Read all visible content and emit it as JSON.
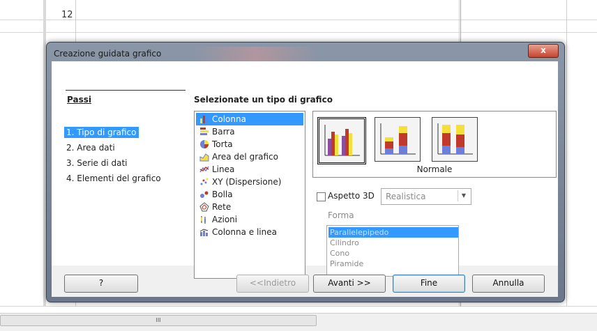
{
  "spreadsheet": {
    "visible_row_number": "12",
    "hscroll_thumb_label": "III"
  },
  "dialog": {
    "title": "Creazione guidata grafico",
    "close_label": "x",
    "steps": {
      "title": "Passi",
      "items": [
        "1. Tipo di grafico",
        "2. Area dati",
        "3. Serie di dati",
        "4. Elementi del grafico"
      ],
      "selected_index": 0
    },
    "chart_type": {
      "section_title": "Selezionate un tipo di grafico",
      "types": [
        {
          "label": "Colonna",
          "icon": "column-chart-icon"
        },
        {
          "label": "Barra",
          "icon": "bar-chart-icon"
        },
        {
          "label": "Torta",
          "icon": "pie-chart-icon"
        },
        {
          "label": "Area del grafico",
          "icon": "area-chart-icon"
        },
        {
          "label": "Linea",
          "icon": "line-chart-icon"
        },
        {
          "label": "XY (Dispersione)",
          "icon": "scatter-chart-icon"
        },
        {
          "label": "Bolla",
          "icon": "bubble-chart-icon"
        },
        {
          "label": "Rete",
          "icon": "net-chart-icon"
        },
        {
          "label": "Azioni",
          "icon": "stock-chart-icon"
        },
        {
          "label": "Colonna e linea",
          "icon": "column-line-chart-icon"
        }
      ],
      "selected_index": 0,
      "variants": [
        "normal",
        "stacked",
        "percent-stacked"
      ],
      "selected_variant": 0,
      "variant_label": "Normale",
      "aspetto_3d": {
        "label": "Aspetto 3D",
        "checked": false
      },
      "combo_value": "Realistica",
      "forma": {
        "label": "Forma",
        "items": [
          "Parallelepipedo",
          "Cilindro",
          "Cono",
          "Piramide"
        ],
        "selected_index": 0
      }
    },
    "buttons": {
      "help": "?",
      "back": "<<Indietro",
      "next": "Avanti >>",
      "finish": "Fine",
      "cancel": "Annulla"
    }
  },
  "colors": {
    "selection": "#3399ff",
    "bar_red": "#c0392b",
    "bar_yellow": "#f4e03a",
    "bar_blue": "#6d7fd8",
    "bar_purple": "#8a4fa0"
  }
}
